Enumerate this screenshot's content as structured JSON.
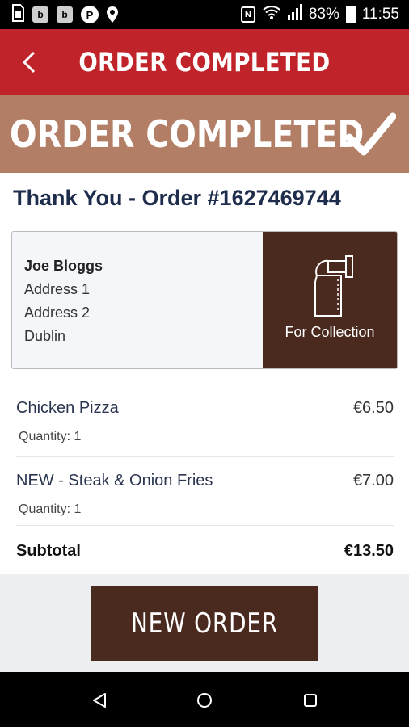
{
  "status_bar": {
    "left_icons": [
      {
        "icon": "sim-card-icon"
      },
      {
        "icon": "b-notification-icon",
        "label": "b"
      },
      {
        "icon": "b-notification-icon",
        "label": "b"
      },
      {
        "icon": "p-notification-icon",
        "label": "P"
      },
      {
        "icon": "location-pin-icon"
      }
    ],
    "nfc_label": "N",
    "battery": "83%",
    "time": "11:55"
  },
  "app_bar": {
    "title": "ORDER COMPLETED",
    "back_icon": "back-chevron-icon"
  },
  "banner": {
    "title": "ORDER COMPLETED",
    "icon": "checkmark-icon"
  },
  "order": {
    "thank_you": "Thank You - Order #1627469744"
  },
  "address": {
    "name": "Joe Bloggs",
    "line1": "Address 1",
    "line2": "Address 2",
    "city": "Dublin"
  },
  "collection": {
    "label": "For Collection",
    "icon": "takeaway-bag-icon"
  },
  "items": [
    {
      "name": "Chicken Pizza",
      "price": "€6.50",
      "quantity": "Quantity: 1"
    },
    {
      "name": "NEW - Steak & Onion Fries",
      "price": "€7.00",
      "quantity": "Quantity: 1"
    }
  ],
  "subtotal": {
    "label": "Subtotal",
    "value": "€13.50"
  },
  "actions": {
    "new_order_label": "NEW ORDER"
  },
  "colors": {
    "app_bar": "#c0242a",
    "banner": "#b27e65",
    "brown": "#4a2a1f",
    "heading": "#1f2d4d"
  },
  "nav": {
    "back_icon": "nav-back-triangle-icon",
    "home_icon": "nav-home-circle-icon",
    "recents_icon": "nav-recents-square-icon"
  }
}
